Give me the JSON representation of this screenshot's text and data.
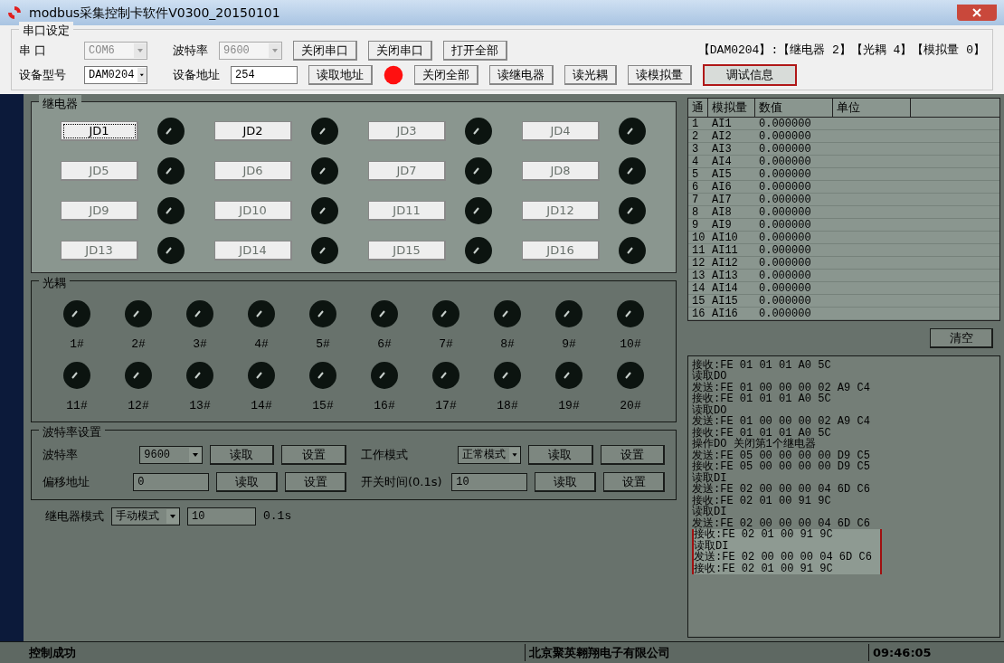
{
  "window": {
    "title": "modbus采集控制卡软件V0300_20150101"
  },
  "serial_settings": {
    "title": "串口设定",
    "port": {
      "label": "串 口",
      "value": "COM6",
      "disabled": true
    },
    "baud": {
      "label": "波特率",
      "value": "9600",
      "disabled": true
    },
    "buttons_row1": [
      "关闭串口",
      "关闭串口",
      "打开全部"
    ],
    "device_info": "【DAM0204】:【继电器  2】【光耦 4】【模拟量 0】",
    "model": {
      "label": "设备型号",
      "value": "DAM0204",
      "disabled": false
    },
    "address": {
      "label": "设备地址",
      "value": "254"
    },
    "read_address_button": "读取地址",
    "status_lamp": {
      "on": true
    },
    "buttons_row2": [
      "关闭全部",
      "读继电器",
      "读光耦",
      "读模拟量"
    ],
    "debug_tab": {
      "label": "调试信息",
      "highlighted": true
    }
  },
  "relays": {
    "title": "继电器",
    "items": [
      {
        "label": "JD1",
        "disabled": false,
        "focused": true,
        "on": false
      },
      {
        "label": "JD2",
        "disabled": false,
        "focused": false,
        "on": false
      },
      {
        "label": "JD3",
        "disabled": true,
        "focused": false,
        "on": false
      },
      {
        "label": "JD4",
        "disabled": true,
        "focused": false,
        "on": false
      },
      {
        "label": "JD5",
        "disabled": true,
        "focused": false,
        "on": false
      },
      {
        "label": "JD6",
        "disabled": true,
        "focused": false,
        "on": false
      },
      {
        "label": "JD7",
        "disabled": true,
        "focused": false,
        "on": false
      },
      {
        "label": "JD8",
        "disabled": true,
        "focused": false,
        "on": false
      },
      {
        "label": "JD9",
        "disabled": true,
        "focused": false,
        "on": false
      },
      {
        "label": "JD10",
        "disabled": true,
        "focused": false,
        "on": false
      },
      {
        "label": "JD11",
        "disabled": true,
        "focused": false,
        "on": false
      },
      {
        "label": "JD12",
        "disabled": true,
        "focused": false,
        "on": false
      },
      {
        "label": "JD13",
        "disabled": true,
        "focused": false,
        "on": false
      },
      {
        "label": "JD14",
        "disabled": true,
        "focused": false,
        "on": false
      },
      {
        "label": "JD15",
        "disabled": true,
        "focused": false,
        "on": false
      },
      {
        "label": "JD16",
        "disabled": true,
        "focused": false,
        "on": false
      }
    ]
  },
  "optocouplers": {
    "title": "光耦",
    "items": [
      {
        "label": "1#",
        "on": false
      },
      {
        "label": "2#",
        "on": false
      },
      {
        "label": "3#",
        "on": false
      },
      {
        "label": "4#",
        "on": false
      },
      {
        "label": "5#",
        "on": false
      },
      {
        "label": "6#",
        "on": false
      },
      {
        "label": "7#",
        "on": false
      },
      {
        "label": "8#",
        "on": false
      },
      {
        "label": "9#",
        "on": false
      },
      {
        "label": "10#",
        "on": false
      },
      {
        "label": "11#",
        "on": false
      },
      {
        "label": "12#",
        "on": false
      },
      {
        "label": "13#",
        "on": false
      },
      {
        "label": "14#",
        "on": false
      },
      {
        "label": "15#",
        "on": false
      },
      {
        "label": "16#",
        "on": false
      },
      {
        "label": "17#",
        "on": false
      },
      {
        "label": "18#",
        "on": false
      },
      {
        "label": "19#",
        "on": false
      },
      {
        "label": "20#",
        "on": false
      }
    ]
  },
  "baud_settings": {
    "title": "波特率设置",
    "baud": {
      "label": "波特率",
      "value": "9600",
      "read": "读取",
      "set": "设置"
    },
    "work_mode": {
      "label": "工作模式",
      "value": "正常模式",
      "read": "读取",
      "set": "设置"
    },
    "offset": {
      "label": "偏移地址",
      "value": "0",
      "read": "读取",
      "set": "设置"
    },
    "switch_time": {
      "label": "开关时间(0.1s)",
      "value": "10",
      "read": "读取",
      "set": "设置"
    }
  },
  "relay_mode": {
    "label": "继电器模式",
    "value": "手动模式",
    "time": "10",
    "unit": "0.1s"
  },
  "analog_table": {
    "columns": [
      "通",
      "模拟量",
      "数值",
      "单位"
    ],
    "rows": [
      [
        "1",
        "AI1",
        "0.000000"
      ],
      [
        "2",
        "AI2",
        "0.000000"
      ],
      [
        "3",
        "AI3",
        "0.000000"
      ],
      [
        "4",
        "AI4",
        "0.000000"
      ],
      [
        "5",
        "AI5",
        "0.000000"
      ],
      [
        "6",
        "AI6",
        "0.000000"
      ],
      [
        "7",
        "AI7",
        "0.000000"
      ],
      [
        "8",
        "AI8",
        "0.000000"
      ],
      [
        "9",
        "AI9",
        "0.000000"
      ],
      [
        "10",
        "AI10",
        "0.000000"
      ],
      [
        "11",
        "AI11",
        "0.000000"
      ],
      [
        "12",
        "AI12",
        "0.000000"
      ],
      [
        "13",
        "AI13",
        "0.000000"
      ],
      [
        "14",
        "AI14",
        "0.000000"
      ],
      [
        "15",
        "AI15",
        "0.000000"
      ],
      [
        "16",
        "AI16",
        "0.000000"
      ]
    ]
  },
  "clear_button": "清空",
  "log": {
    "lines": [
      {
        "text": "接收:FE 01 01 01 A0 5C",
        "highlighted": false
      },
      {
        "text": "读取DO",
        "highlighted": false
      },
      {
        "text": "发送:FE 01 00 00 00 02 A9 C4",
        "highlighted": false
      },
      {
        "text": "接收:FE 01 01 01 A0 5C",
        "highlighted": false
      },
      {
        "text": "读取DO",
        "highlighted": false
      },
      {
        "text": "发送:FE 01 00 00 00 02 A9 C4",
        "highlighted": false
      },
      {
        "text": "接收:FE 01 01 01 A0 5C",
        "highlighted": false
      },
      {
        "text": "操作DO  关闭第1个继电器",
        "highlighted": false
      },
      {
        "text": "发送:FE 05 00 00 00 00 D9 C5",
        "highlighted": false
      },
      {
        "text": "接收:FE 05 00 00 00 00 D9 C5",
        "highlighted": false
      },
      {
        "text": "读取DI",
        "highlighted": false
      },
      {
        "text": "发送:FE 02 00 00 00 04 6D C6",
        "highlighted": false
      },
      {
        "text": "接收:FE 02 01 00 91 9C",
        "highlighted": false
      },
      {
        "text": "读取DI",
        "highlighted": false
      },
      {
        "text": "发送:FE 02 00 00 00 04 6D C6",
        "highlighted": false
      },
      {
        "text": "接收:FE 02 01 00 91 9C",
        "highlighted": true
      },
      {
        "text": "读取DI",
        "highlighted": true
      },
      {
        "text": "发送:FE 02 00 00 00 04 6D C6",
        "highlighted": true
      },
      {
        "text": "接收:FE 02 01 00 91 9C",
        "highlighted": true
      }
    ]
  },
  "status_bar": [
    "控制成功",
    "北京聚英翱翔电子有限公司",
    "09:46:05"
  ]
}
